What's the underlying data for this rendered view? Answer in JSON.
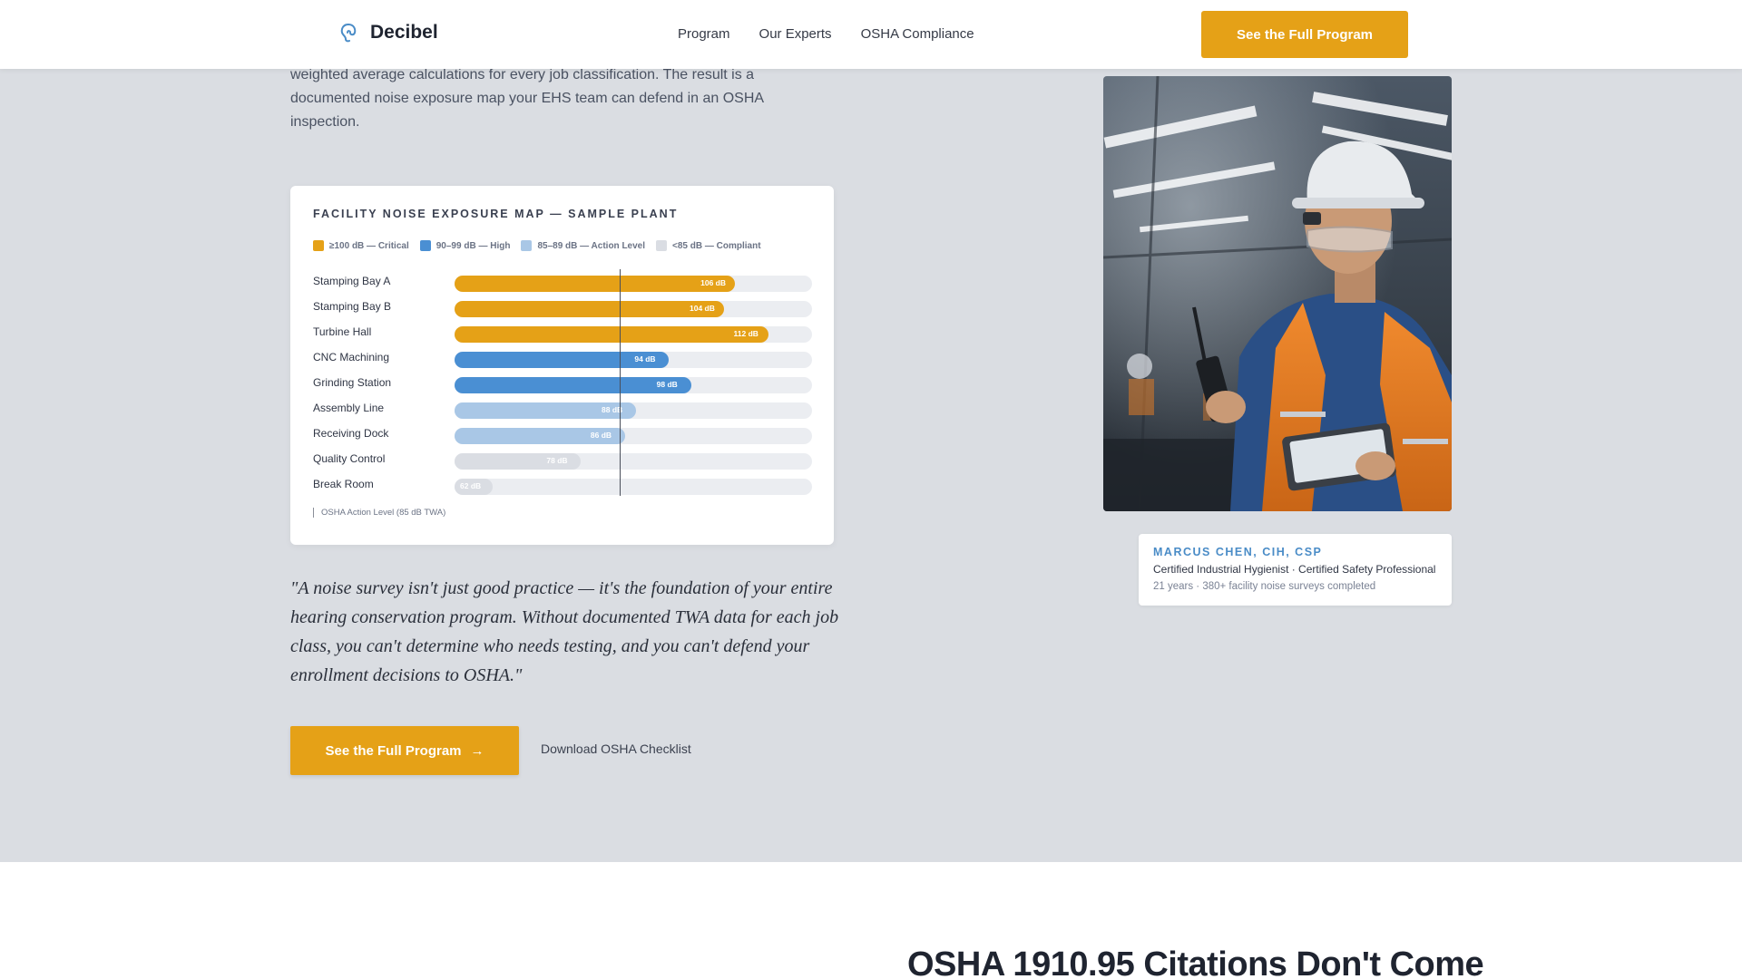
{
  "header": {
    "brand": "Decibel",
    "nav": [
      "Program",
      "Our Experts",
      "OSHA Compliance"
    ],
    "cta_label": "See the Full Program"
  },
  "hero": {
    "intro_text": "personal dosimeters on workers, area monitoring at fixed positions, and time-weighted average calculations for every job classification. The result is a documented noise exposure map your EHS team can defend in an OSHA inspection.",
    "quote": "\"A noise survey isn't just good practice — it's the foundation of your entire hearing conservation program. Without documented TWA data for each job class, you can't determine who needs testing, and you can't defend your enrollment decisions to OSHA.\"",
    "primary_cta": "See the Full Program",
    "primary_cta_arrow": "→",
    "secondary_link": "Download OSHA Checklist"
  },
  "chart_card": {
    "title": "FACILITY NOISE EXPOSURE MAP — SAMPLE PLANT",
    "legend": [
      {
        "label": "≥100 dB — Critical",
        "color": "#e5a117"
      },
      {
        "label": "90–99 dB — High",
        "color": "#4a8fd3"
      },
      {
        "label": "85–89 dB — Action Level",
        "color": "#a9c7e6"
      },
      {
        "label": "<85 dB — Compliant",
        "color": "#dadde3"
      }
    ],
    "marker_note": "OSHA Action Level (85 dB TWA)"
  },
  "chart_data": {
    "type": "bar",
    "orientation": "horizontal",
    "title": "FACILITY NOISE EXPOSURE MAP — SAMPLE PLANT",
    "categories": [
      "Stamping Bay A",
      "Stamping Bay B",
      "Turbine Hall",
      "CNC Machining",
      "Grinding Station",
      "Assembly Line",
      "Receiving Dock",
      "Quality Control",
      "Break Room"
    ],
    "values": [
      106,
      104,
      112,
      94,
      98,
      88,
      86,
      78,
      62
    ],
    "value_labels": [
      "106 dB",
      "104 dB",
      "112 dB",
      "94 dB",
      "98 dB",
      "88 dB",
      "86 dB",
      "78 dB",
      "62 dB"
    ],
    "unit": "dB",
    "xlim": [
      55,
      120
    ],
    "reference_line": {
      "value": 85,
      "label": "OSHA Action Level (85 dB TWA)"
    },
    "colors": {
      "critical": "#e5a117",
      "high": "#4a8fd3",
      "action": "#a9c7e6",
      "compliant": "#dadde3"
    }
  },
  "expert": {
    "name": "MARCUS CHEN, CIH, CSP",
    "title": "Certified Industrial Hygienist · Certified Safety Professional",
    "meta": "21 years · 380+ facility noise surveys completed",
    "photo_icon": "worker-with-tablet-photo"
  },
  "next_section": {
    "heading": "OSHA 1910.95 Citations Don't Come"
  },
  "colors": {
    "accent": "#e5a117",
    "hero_bg": "#dadde2",
    "expert_name": "#4a8cc7"
  }
}
